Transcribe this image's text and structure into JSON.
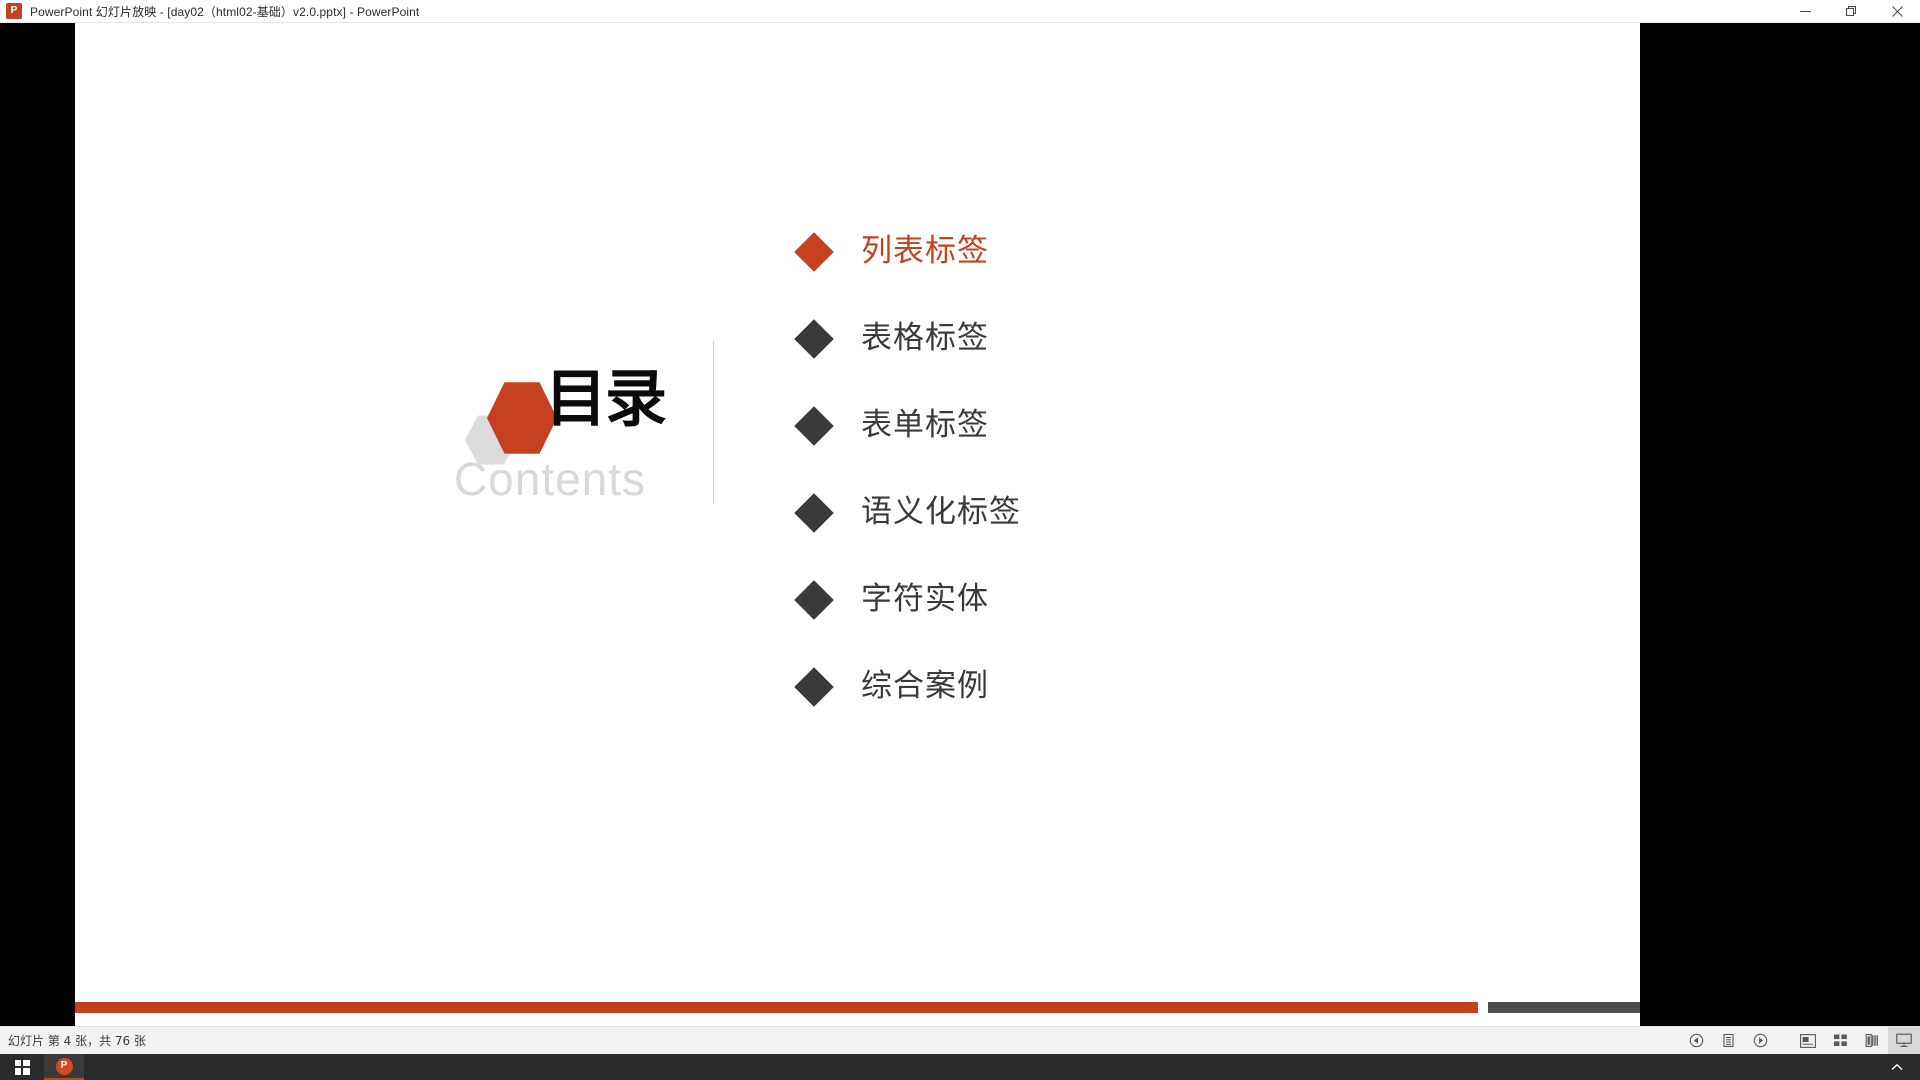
{
  "window": {
    "title": "PowerPoint 幻灯片放映 - [day02（html02-基础）v2.0.pptx] - PowerPoint",
    "app_icon_glyph": "P",
    "app_icon_name": "powerpoint-icon",
    "controls": {
      "minimize_label": "最小化",
      "restore_label": "向下还原",
      "close_label": "关闭"
    }
  },
  "slide": {
    "title_cn": "目录",
    "title_en": "Contents",
    "accent_color": "#c5411f",
    "text_color": "#3a3a3a",
    "items": [
      {
        "label": "列表标签",
        "active": true
      },
      {
        "label": "表格标签",
        "active": false
      },
      {
        "label": "表单标签",
        "active": false
      },
      {
        "label": "语义化标签",
        "active": false
      },
      {
        "label": "字符实体",
        "active": false
      },
      {
        "label": "综合案例",
        "active": false
      }
    ]
  },
  "status": {
    "text": "幻灯片 第 4 张，共 76 张",
    "current_slide": 4,
    "total_slides": 76,
    "buttons": [
      {
        "name": "previous-slide-button",
        "title": "上一张"
      },
      {
        "name": "notes-button",
        "title": "备注"
      },
      {
        "name": "next-slide-button",
        "title": "下一张"
      },
      {
        "name": "normal-view-button",
        "title": "普通视图"
      },
      {
        "name": "slide-sorter-button",
        "title": "幻灯片浏览"
      },
      {
        "name": "reading-view-button",
        "title": "阅读视图"
      },
      {
        "name": "slideshow-view-button",
        "title": "幻灯片放映",
        "selected": true
      }
    ]
  },
  "taskbar": {
    "start_label": "开始",
    "items": [
      {
        "name": "taskbar-powerpoint",
        "glyph": "P",
        "label": "PowerPoint"
      }
    ],
    "tray": {
      "show_hidden_icons_label": "显示隐藏的图标"
    }
  }
}
